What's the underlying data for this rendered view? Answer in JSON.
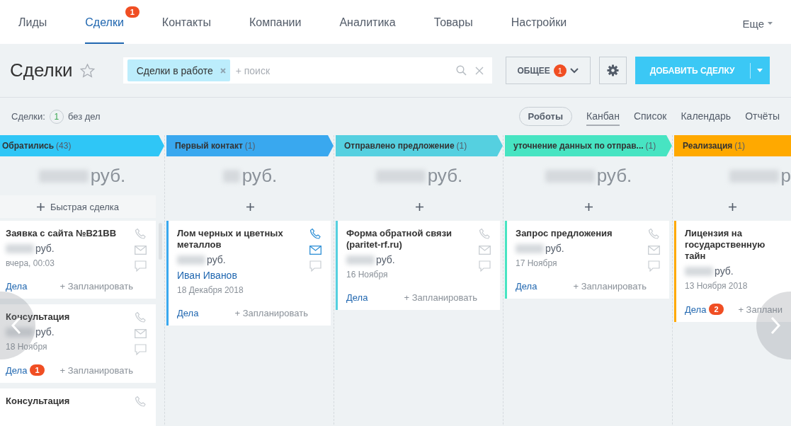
{
  "nav": {
    "tabs": [
      {
        "label": "Лиды",
        "selected": false
      },
      {
        "label": "Сделки",
        "selected": true,
        "badge": "1"
      },
      {
        "label": "Контакты",
        "selected": false
      },
      {
        "label": "Компании",
        "selected": false
      },
      {
        "label": "Аналитика",
        "selected": false
      },
      {
        "label": "Товары",
        "selected": false
      },
      {
        "label": "Настройки",
        "selected": false
      }
    ],
    "more": "Еще"
  },
  "toolbar": {
    "title": "Сделки",
    "search": {
      "chip": "Сделки в работе",
      "placeholder": "+ поиск"
    },
    "preset": {
      "label": "ОБЩЕЕ",
      "badge": "1"
    },
    "add_button": "ДОБАВИТЬ СДЕЛКУ"
  },
  "subbar": {
    "label": "Сделки:",
    "count": "1",
    "suffix": "без дел",
    "robots": "Роботы",
    "views": [
      {
        "label": "Канбан",
        "selected": true
      },
      {
        "label": "Список",
        "selected": false
      },
      {
        "label": "Календарь",
        "selected": false
      },
      {
        "label": "Отчёты",
        "selected": false
      }
    ]
  },
  "columns": [
    {
      "title": "Обратились",
      "count": "(43)",
      "color": "#2fc6f6",
      "sum": "руб.",
      "add_label": "Быстрая сделка",
      "accent": false,
      "cards": [
        {
          "title": "Заявка с сайта №B21BB",
          "amount": "руб.",
          "date": "вчера, 00:03",
          "deals": "Дела",
          "plan": "+ Запланировать",
          "icons": [
            {
              "kind": "phone",
              "active": false
            },
            {
              "kind": "mail",
              "active": false
            },
            {
              "kind": "chat",
              "active": false
            }
          ]
        },
        {
          "title": "Консультация",
          "amount": "руб.",
          "date": "18 Ноября",
          "deals": "Дела",
          "deals_badge": "1",
          "plan": "+ Запланировать",
          "icons": [
            {
              "kind": "phone",
              "active": false
            },
            {
              "kind": "mail",
              "active": false
            },
            {
              "kind": "chat",
              "active": false
            }
          ]
        },
        {
          "title": "Консультация",
          "icons": [
            {
              "kind": "phone",
              "active": false
            }
          ]
        }
      ]
    },
    {
      "title": "Первый контакт",
      "count": "(1)",
      "color": "#39a8ef",
      "sum": "руб.",
      "accent": true,
      "cards": [
        {
          "title": "Лом черных и цветных металлов",
          "amount": "руб.",
          "contact": "Иван Иванов",
          "date": "18 Декабря 2018",
          "deals": "Дела",
          "plan": "+ Запланировать",
          "icons": [
            {
              "kind": "phone",
              "active": true
            },
            {
              "kind": "mail",
              "active": true
            },
            {
              "kind": "chat",
              "active": false
            }
          ]
        }
      ]
    },
    {
      "title": "Отправлено предложение",
      "count": "(1)",
      "color": "#55d0e0",
      "sum": "руб.",
      "accent": true,
      "cards": [
        {
          "title": "Форма обратной связи (paritet-rf.ru)",
          "amount": "руб.",
          "date": "16 Ноября",
          "deals": "Дела",
          "plan": "+ Запланировать",
          "icons": [
            {
              "kind": "phone",
              "active": false
            },
            {
              "kind": "mail",
              "active": false
            },
            {
              "kind": "chat",
              "active": false
            }
          ]
        }
      ]
    },
    {
      "title": "уточнение данных по отправ...",
      "count": "(1)",
      "color": "#47e4c2",
      "sum": "руб.",
      "accent": true,
      "cards": [
        {
          "title": "Запрос предложения",
          "amount": "руб.",
          "date": "17 Ноября",
          "deals": "Дела",
          "plan": "+ Запланировать",
          "icons": [
            {
              "kind": "phone",
              "active": false
            },
            {
              "kind": "mail",
              "active": false
            },
            {
              "kind": "chat",
              "active": false
            }
          ]
        }
      ]
    },
    {
      "title": "Реализация",
      "count": "(1)",
      "color": "#ffa900",
      "sum": "р",
      "accent": true,
      "cards": [
        {
          "title": "Лицензия на государственную тайн",
          "amount": "руб.",
          "date": "13 Ноября 2018",
          "deals": "Дела",
          "deals_badge": "2",
          "plan": "+ Заплани"
        }
      ]
    }
  ]
}
